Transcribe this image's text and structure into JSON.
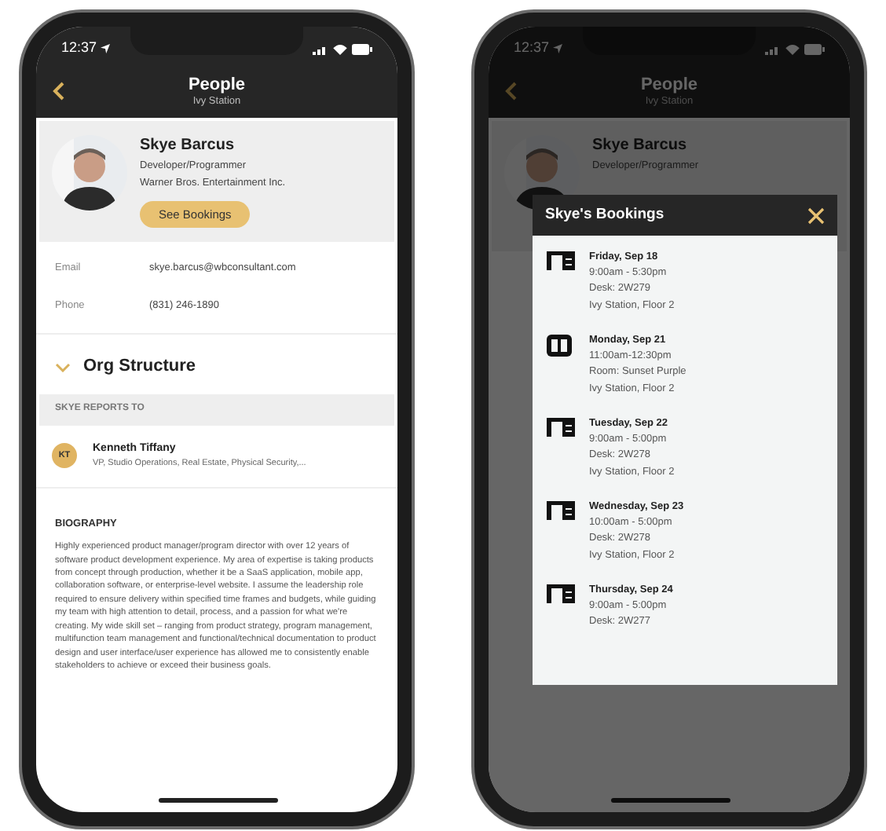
{
  "left_phone": {
    "status_bar": {
      "time": "12:37"
    },
    "header": {
      "title": "People",
      "subtitle": "Ivy Station"
    },
    "profile": {
      "name": "Skye Barcus",
      "role": "Developer/Programmer",
      "company": "Warner Bros. Entertainment Inc.",
      "button": "See Bookings"
    },
    "contact": [
      {
        "label": "Email",
        "value": "skye.barcus@wbconsultant.com"
      },
      {
        "label": "Phone",
        "value": "(831) 246-1890"
      }
    ],
    "org_structure": {
      "title": "Org Structure",
      "expanded": true,
      "section": "SKYE REPORTS TO",
      "manager": {
        "initials": "KT",
        "name": "Kenneth Tiffany",
        "title": "VP, Studio Operations, Real Estate, Physical Security,..."
      }
    },
    "biography": {
      "title": "BIOGRAPHY",
      "text": "Highly experienced product manager/program director with over 12 years of software product development experience. My area of expertise is taking products from concept through production, whether it be a SaaS application, mobile app, collaboration software, or enterprise-level website. I assume the leadership role required to ensure delivery within specified time frames and budgets, while guiding my team with high attention to detail, process, and a passion for what we're creating. My wide skill set – ranging from product strategy, program management, multifunction team management and functional/technical documentation to product design and user interface/user experience has allowed me to consistently enable stakeholders to achieve or exceed their business goals."
    }
  },
  "right_phone": {
    "status_bar": {
      "time": "12:37"
    },
    "header": {
      "title": "People",
      "subtitle": "Ivy Station"
    },
    "profile": {
      "name": "Skye Barcus",
      "role": "Developer/Programmer"
    },
    "modal": {
      "title": "Skye's Bookings",
      "bookings": [
        {
          "kind": "desk",
          "day": "Friday, Sep 18",
          "time": "9:00am - 5:30pm",
          "space": "Desk: 2W279",
          "location": "Ivy Station, Floor 2"
        },
        {
          "kind": "room",
          "day": "Monday, Sep 21",
          "time": "11:00am-12:30pm",
          "space": "Room: Sunset Purple",
          "location": "Ivy Station, Floor 2"
        },
        {
          "kind": "desk",
          "day": "Tuesday, Sep 22",
          "time": "9:00am - 5:00pm",
          "space": "Desk: 2W278",
          "location": "Ivy Station, Floor 2"
        },
        {
          "kind": "desk",
          "day": "Wednesday, Sep 23",
          "time": "10:00am - 5:00pm",
          "space": "Desk: 2W278",
          "location": "Ivy Station, Floor 2"
        },
        {
          "kind": "desk",
          "day": "Thursday, Sep 24",
          "time": "9:00am - 5:00pm",
          "space": "Desk: 2W277"
        }
      ]
    }
  }
}
